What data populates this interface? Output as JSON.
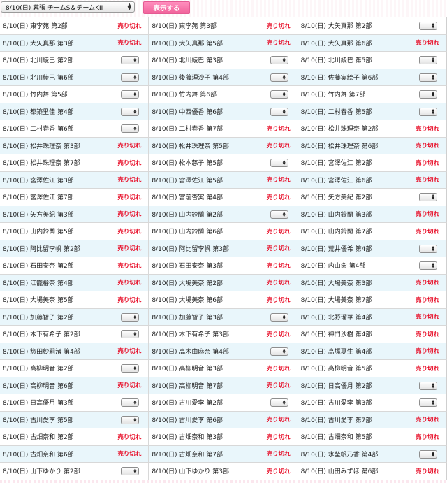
{
  "toolbar": {
    "selected_event": "8/10(日) 幕張 チームS＆チームKII",
    "show_label": "表示する"
  },
  "labels": {
    "sold_out": "売り切れ"
  },
  "rows": [
    [
      {
        "t": "8/10(日) 東李苑 第2部",
        "s": "sold"
      },
      {
        "t": "8/10(日) 東李苑 第3部",
        "s": "sold"
      },
      {
        "t": "8/10(日) 大矢真那 第2部",
        "s": "select"
      }
    ],
    [
      {
        "t": "8/10(日) 大矢真那 第3部",
        "s": "sold"
      },
      {
        "t": "8/10(日) 大矢真那 第5部",
        "s": "sold"
      },
      {
        "t": "8/10(日) 大矢真那 第6部",
        "s": "sold"
      }
    ],
    [
      {
        "t": "8/10(日) 北川綾巴 第2部",
        "s": "select"
      },
      {
        "t": "8/10(日) 北川綾巴 第3部",
        "s": "select"
      },
      {
        "t": "8/10(日) 北川綾巴 第5部",
        "s": "select"
      }
    ],
    [
      {
        "t": "8/10(日) 北川綾巴 第6部",
        "s": "select"
      },
      {
        "t": "8/10(日) 後藤理沙子 第4部",
        "s": "select"
      },
      {
        "t": "8/10(日) 佐藤実絵子 第6部",
        "s": "select"
      }
    ],
    [
      {
        "t": "8/10(日) 竹内舞 第5部",
        "s": "select"
      },
      {
        "t": "8/10(日) 竹内舞 第6部",
        "s": "select"
      },
      {
        "t": "8/10(日) 竹内舞 第7部",
        "s": "select"
      }
    ],
    [
      {
        "t": "8/10(日) 都築里佳 第4部",
        "s": "select"
      },
      {
        "t": "8/10(日) 中西優香 第6部",
        "s": "select"
      },
      {
        "t": "8/10(日) 二村春香 第5部",
        "s": "select"
      }
    ],
    [
      {
        "t": "8/10(日) 二村春香 第6部",
        "s": "select"
      },
      {
        "t": "8/10(日) 二村春香 第7部",
        "s": "sold"
      },
      {
        "t": "8/10(日) 松井珠理奈 第2部",
        "s": "sold"
      }
    ],
    [
      {
        "t": "8/10(日) 松井珠理奈 第3部",
        "s": "sold"
      },
      {
        "t": "8/10(日) 松井珠理奈 第5部",
        "s": "sold"
      },
      {
        "t": "8/10(日) 松井珠理奈 第6部",
        "s": "sold"
      }
    ],
    [
      {
        "t": "8/10(日) 松井珠理奈 第7部",
        "s": "sold"
      },
      {
        "t": "8/10(日) 松本慈子 第5部",
        "s": "select"
      },
      {
        "t": "8/10(日) 宮澤佐江 第2部",
        "s": "sold"
      }
    ],
    [
      {
        "t": "8/10(日) 宮澤佐江 第3部",
        "s": "sold"
      },
      {
        "t": "8/10(日) 宮澤佐江 第5部",
        "s": "sold"
      },
      {
        "t": "8/10(日) 宮澤佐江 第6部",
        "s": "sold"
      }
    ],
    [
      {
        "t": "8/10(日) 宮澤佐江 第7部",
        "s": "sold"
      },
      {
        "t": "8/10(日) 宮前杏実 第4部",
        "s": "sold"
      },
      {
        "t": "8/10(日) 矢方美紀 第2部",
        "s": "select"
      }
    ],
    [
      {
        "t": "8/10(日) 矢方美紀 第3部",
        "s": "sold"
      },
      {
        "t": "8/10(日) 山内鈴蘭 第2部",
        "s": "select"
      },
      {
        "t": "8/10(日) 山内鈴蘭 第3部",
        "s": "sold"
      }
    ],
    [
      {
        "t": "8/10(日) 山内鈴蘭 第5部",
        "s": "sold"
      },
      {
        "t": "8/10(日) 山内鈴蘭 第6部",
        "s": "sold"
      },
      {
        "t": "8/10(日) 山内鈴蘭 第7部",
        "s": "sold"
      }
    ],
    [
      {
        "t": "8/10(日) 阿比留李帆 第2部",
        "s": "sold"
      },
      {
        "t": "8/10(日) 阿比留李帆 第3部",
        "s": "sold"
      },
      {
        "t": "8/10(日) 荒井優希 第4部",
        "s": "select"
      }
    ],
    [
      {
        "t": "8/10(日) 石田安奈 第2部",
        "s": "sold"
      },
      {
        "t": "8/10(日) 石田安奈 第3部",
        "s": "sold"
      },
      {
        "t": "8/10(日) 内山命 第4部",
        "s": "select"
      }
    ],
    [
      {
        "t": "8/10(日) 江籠裕奈 第4部",
        "s": "sold"
      },
      {
        "t": "8/10(日) 大場美奈 第2部",
        "s": "sold"
      },
      {
        "t": "8/10(日) 大場美奈 第3部",
        "s": "sold"
      }
    ],
    [
      {
        "t": "8/10(日) 大場美奈 第5部",
        "s": "sold"
      },
      {
        "t": "8/10(日) 大場美奈 第6部",
        "s": "sold"
      },
      {
        "t": "8/10(日) 大場美奈 第7部",
        "s": "sold"
      }
    ],
    [
      {
        "t": "8/10(日) 加藤智子 第2部",
        "s": "select"
      },
      {
        "t": "8/10(日) 加藤智子 第3部",
        "s": "select"
      },
      {
        "t": "8/10(日) 北野瑠華 第4部",
        "s": "sold"
      }
    ],
    [
      {
        "t": "8/10(日) 木下有希子 第2部",
        "s": "select"
      },
      {
        "t": "8/10(日) 木下有希子 第3部",
        "s": "sold"
      },
      {
        "t": "8/10(日) 神門沙樹 第4部",
        "s": "sold"
      }
    ],
    [
      {
        "t": "8/10(日) 惣田紗莉渚 第4部",
        "s": "sold"
      },
      {
        "t": "8/10(日) 高木由麻奈 第4部",
        "s": "select"
      },
      {
        "t": "8/10(日) 高塚夏生 第4部",
        "s": "sold"
      }
    ],
    [
      {
        "t": "8/10(日) 高柳明音 第2部",
        "s": "select"
      },
      {
        "t": "8/10(日) 高柳明音 第3部",
        "s": "sold"
      },
      {
        "t": "8/10(日) 高柳明音 第5部",
        "s": "sold"
      }
    ],
    [
      {
        "t": "8/10(日) 高柳明音 第6部",
        "s": "sold"
      },
      {
        "t": "8/10(日) 高柳明音 第7部",
        "s": "sold"
      },
      {
        "t": "8/10(日) 日高優月 第2部",
        "s": "select"
      }
    ],
    [
      {
        "t": "8/10(日) 日高優月 第3部",
        "s": "select"
      },
      {
        "t": "8/10(日) 古川愛李 第2部",
        "s": "select"
      },
      {
        "t": "8/10(日) 古川愛李 第3部",
        "s": "select"
      }
    ],
    [
      {
        "t": "8/10(日) 古川愛李 第5部",
        "s": "select"
      },
      {
        "t": "8/10(日) 古川愛李 第6部",
        "s": "sold"
      },
      {
        "t": "8/10(日) 古川愛李 第7部",
        "s": "sold"
      }
    ],
    [
      {
        "t": "8/10(日) 古畑奈和 第2部",
        "s": "sold"
      },
      {
        "t": "8/10(日) 古畑奈和 第3部",
        "s": "sold"
      },
      {
        "t": "8/10(日) 古畑奈和 第5部",
        "s": "sold"
      }
    ],
    [
      {
        "t": "8/10(日) 古畑奈和 第6部",
        "s": "sold"
      },
      {
        "t": "8/10(日) 古畑奈和 第7部",
        "s": "sold"
      },
      {
        "t": "8/10(日) 水埜帆乃香 第4部",
        "s": "select"
      }
    ],
    [
      {
        "t": "8/10(日) 山下ゆかり 第2部",
        "s": "select"
      },
      {
        "t": "8/10(日) 山下ゆかり 第3部",
        "s": "sold"
      },
      {
        "t": "8/10(日) 山田みずほ 第6部",
        "s": "sold"
      }
    ]
  ]
}
